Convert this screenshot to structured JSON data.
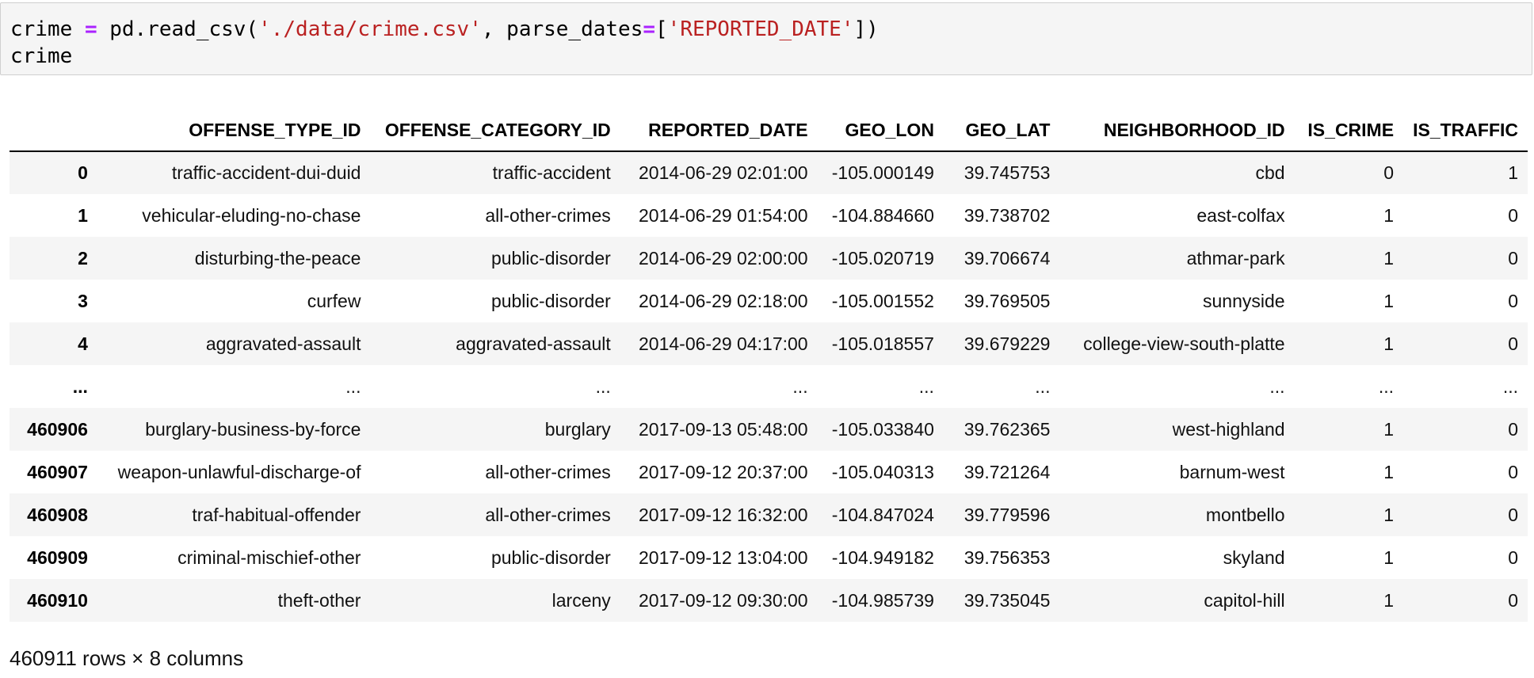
{
  "code_cell": {
    "line1": {
      "var": "crime",
      "op": "=",
      "call_start": "pd.read_csv(",
      "path": "'./data/crime.csv'",
      "kwarg": ", parse_dates",
      "kwarg_op": "=",
      "list_open": "[",
      "date_col": "'REPORTED_DATE'",
      "close": "])"
    },
    "line2": "crime"
  },
  "dataframe": {
    "columns": [
      "OFFENSE_TYPE_ID",
      "OFFENSE_CATEGORY_ID",
      "REPORTED_DATE",
      "GEO_LON",
      "GEO_LAT",
      "NEIGHBORHOOD_ID",
      "IS_CRIME",
      "IS_TRAFFIC"
    ],
    "rows": [
      {
        "index": "0",
        "cells": [
          "traffic-accident-dui-duid",
          "traffic-accident",
          "2014-06-29 02:01:00",
          "-105.000149",
          "39.745753",
          "cbd",
          "0",
          "1"
        ]
      },
      {
        "index": "1",
        "cells": [
          "vehicular-eluding-no-chase",
          "all-other-crimes",
          "2014-06-29 01:54:00",
          "-104.884660",
          "39.738702",
          "east-colfax",
          "1",
          "0"
        ]
      },
      {
        "index": "2",
        "cells": [
          "disturbing-the-peace",
          "public-disorder",
          "2014-06-29 02:00:00",
          "-105.020719",
          "39.706674",
          "athmar-park",
          "1",
          "0"
        ]
      },
      {
        "index": "3",
        "cells": [
          "curfew",
          "public-disorder",
          "2014-06-29 02:18:00",
          "-105.001552",
          "39.769505",
          "sunnyside",
          "1",
          "0"
        ]
      },
      {
        "index": "4",
        "cells": [
          "aggravated-assault",
          "aggravated-assault",
          "2014-06-29 04:17:00",
          "-105.018557",
          "39.679229",
          "college-view-south-platte",
          "1",
          "0"
        ]
      },
      {
        "index": "...",
        "cells": [
          "...",
          "...",
          "...",
          "...",
          "...",
          "...",
          "...",
          "..."
        ]
      },
      {
        "index": "460906",
        "cells": [
          "burglary-business-by-force",
          "burglary",
          "2017-09-13 05:48:00",
          "-105.033840",
          "39.762365",
          "west-highland",
          "1",
          "0"
        ]
      },
      {
        "index": "460907",
        "cells": [
          "weapon-unlawful-discharge-of",
          "all-other-crimes",
          "2017-09-12 20:37:00",
          "-105.040313",
          "39.721264",
          "barnum-west",
          "1",
          "0"
        ]
      },
      {
        "index": "460908",
        "cells": [
          "traf-habitual-offender",
          "all-other-crimes",
          "2017-09-12 16:32:00",
          "-104.847024",
          "39.779596",
          "montbello",
          "1",
          "0"
        ]
      },
      {
        "index": "460909",
        "cells": [
          "criminal-mischief-other",
          "public-disorder",
          "2017-09-12 13:04:00",
          "-104.949182",
          "39.756353",
          "skyland",
          "1",
          "0"
        ]
      },
      {
        "index": "460910",
        "cells": [
          "theft-other",
          "larceny",
          "2017-09-12 09:30:00",
          "-104.985739",
          "39.735045",
          "capitol-hill",
          "1",
          "0"
        ]
      }
    ],
    "shape_text": "460911 rows × 8 columns"
  },
  "colors": {
    "string": "#ba2121",
    "operator": "#aa22ff",
    "cell_bg": "#f5f5f5",
    "stripe": "#f5f5f5"
  }
}
